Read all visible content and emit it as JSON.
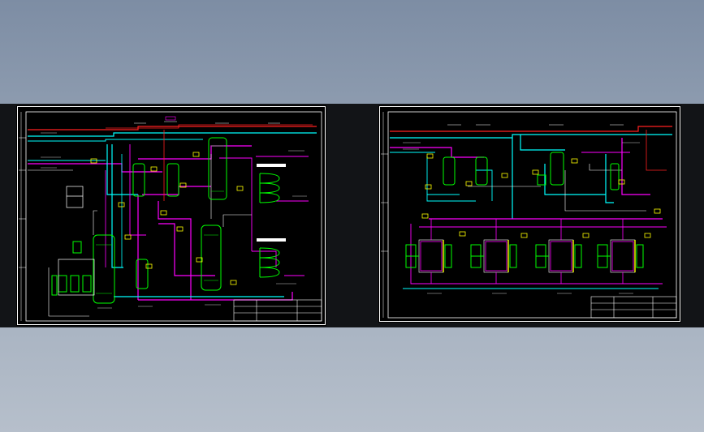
{
  "viewer": {
    "background_top": "#7d8da4",
    "background_bottom": "#b6bfcb"
  },
  "colors": {
    "steam": "#ff00ff",
    "water": "#00ffff",
    "hot": "#ff2020",
    "vessel": "#00ff00",
    "instrument": "#ffff00",
    "line": "#ffffff"
  },
  "sheets": [
    {
      "id": "sheet-1",
      "title_block": "",
      "drawing_no": ""
    },
    {
      "id": "sheet-2",
      "title_block": "",
      "drawing_no": ""
    }
  ]
}
